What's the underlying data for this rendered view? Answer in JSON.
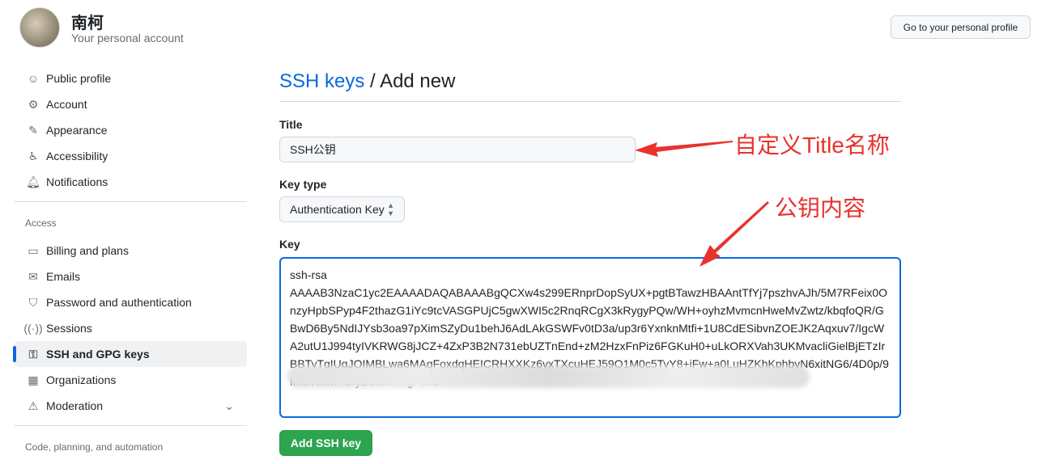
{
  "user": {
    "name": "南柯",
    "subtitle": "Your personal account"
  },
  "header": {
    "profile_button": "Go to your personal profile"
  },
  "sidebar": {
    "items": [
      {
        "label": "Public profile",
        "icon": "person-icon"
      },
      {
        "label": "Account",
        "icon": "gear-icon"
      },
      {
        "label": "Appearance",
        "icon": "paintbrush-icon"
      },
      {
        "label": "Accessibility",
        "icon": "accessibility-icon"
      },
      {
        "label": "Notifications",
        "icon": "bell-icon"
      }
    ],
    "access_label": "Access",
    "access_items": [
      {
        "label": "Billing and plans",
        "icon": "credit-card-icon"
      },
      {
        "label": "Emails",
        "icon": "mail-icon"
      },
      {
        "label": "Password and authentication",
        "icon": "shield-icon"
      },
      {
        "label": "Sessions",
        "icon": "broadcast-icon"
      },
      {
        "label": "SSH and GPG keys",
        "icon": "key-icon",
        "active": true
      },
      {
        "label": "Organizations",
        "icon": "organization-icon"
      },
      {
        "label": "Moderation",
        "icon": "report-icon"
      }
    ],
    "code_label": "Code, planning, and automation"
  },
  "main": {
    "breadcrumb_link": "SSH keys",
    "breadcrumb_sep": " / ",
    "breadcrumb_current": "Add new",
    "title_label": "Title",
    "title_value": "SSH公钥",
    "keytype_label": "Key type",
    "keytype_value": "Authentication Key",
    "key_label": "Key",
    "key_value": "ssh-rsa\nAAAAB3NzaC1yc2EAAAADAQABAAABgQCXw4s299ERnprDopSyUX+pgtBTawzHBAAntTfYj7pszhvAJh/5M7RFeix0OnzyHpbSPyp4F2thazG1iYc9tcVASGPUjC5gwXWI5c2RnqRCgX3kRygyPQw/WH+oyhzMvmcnHweMvZwtz/kbqfoQR/GBwD6By5NdIJYsb3oa97pXimSZyDu1behJ6AdLAkGSWFv0tD3a/up3r6YxnknMtfi+1U8CdESibvnZOEJK2Aqxuv7/IgcWA2utU1J994tyIVKRWG8jJCZ+4ZxP3B2N731ebUZTnEnd+zM2HzxFnPiz6FGKuH0+uLkORXVah3UKMvacliGielBjETzIrBBTyTgIUgJOIMBLwa6MAqFoxdqHEICRHXXKz6yxTXcuHEJ59Q1M0c5TyY8+iFw+a0LuHZKhKphbyN6xitNG6/4D0p/9fM6VZdwPBiyZGkmTHgP6xz",
    "add_button": "Add SSH key"
  },
  "annotations": {
    "title": "自定义Title名称",
    "key": "公钥内容",
    "color": "#e8322e"
  }
}
